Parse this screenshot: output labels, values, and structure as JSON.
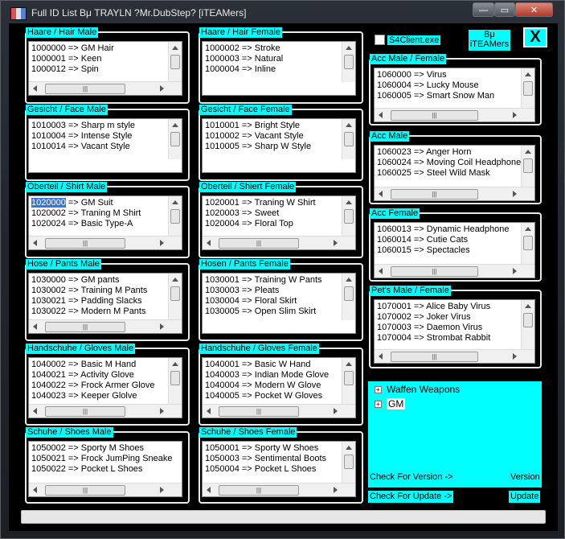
{
  "window": {
    "title": "Full ID List Bμ TRAYLN  ?Mr.DubStep? [iTEAMers]",
    "min_label": "—",
    "max_label": "▭",
    "close_label": "✕"
  },
  "checkbox": {
    "label": "S4Client.exe",
    "checked": false
  },
  "by_box": {
    "line1": "Bμ",
    "line2": "iTEAMers"
  },
  "x_button": "X",
  "groups": {
    "hair_male": {
      "label": "Haare / Hair Male",
      "items": [
        "1000000 => GM Hair",
        "1000001 => Keen",
        "1000012 => Spin"
      ]
    },
    "hair_female": {
      "label": "Haare / Hair Female",
      "items": [
        "1000002 => Stroke",
        "1000003 => Natural",
        "1000004 => Inline"
      ]
    },
    "face_male": {
      "label": "Gesicht / Face Male",
      "items": [
        "1010003 => Sharp m style",
        "1010004 => Intense Style",
        "1010014 => Vacant Style"
      ]
    },
    "face_female": {
      "label": "Gesicht / Face Female",
      "items": [
        "1010001 => Bright Style",
        "1010002 => Vacant Style",
        "1010005 => Sharp W Style"
      ]
    },
    "shirt_male": {
      "label": "Oberteil / Shirt Male",
      "selected_id": "1020000",
      "selected_rest": " => GM Suit",
      "items": [
        "1020002 => Traning M Shirt",
        "1020024 => Basic Type-A"
      ]
    },
    "shirt_female": {
      "label": "Oberteil / Shiert Female",
      "items": [
        "1020001 => Traning W Shirt",
        "1020003 => Sweet",
        "1020004 => Floral Top"
      ]
    },
    "pants_male": {
      "label": "Hose / Pants Male",
      "items": [
        "1030000 => GM pants",
        "1030002 => Training M Pants",
        "1030021 => Padding Slacks",
        "1030022 => Modern M Pants"
      ]
    },
    "pants_female": {
      "label": "Hosen / Pants Female",
      "items": [
        "1030001 => Training W Pants",
        "1030003 => Pleats",
        "1030004 => Floral Skirt",
        "1030005 => Open Slim Skirt"
      ]
    },
    "gloves_male": {
      "label": "Handschuhe / Gloves  Male",
      "items": [
        "1040002 => Basic M Hand",
        "1040021 => Activity Glove",
        "1040022 => Frock Armer Glove",
        "1040023 => Keeper Glolve"
      ]
    },
    "gloves_female": {
      "label": "Handschuhe / Gloves Female",
      "items": [
        "1040001 => Basic W Hand",
        "1040003 => Indian Mode Glove",
        "1040004 => Modern W Glove",
        "1040005 => Pocket W Gloves"
      ]
    },
    "shoes_male": {
      "label": "Schuhe / Shoes Male",
      "items": [
        "1050002 => Sporty M Shoes",
        "1050021 => Frock JumPing Sneake",
        "1050022 => Pocket L Shoes"
      ]
    },
    "shoes_female": {
      "label": "Schuhe / Shoes Female",
      "items": [
        "1050001 => Sporty W Shoes",
        "1050003 => Sentimental Boots",
        "1050004 => Pocket L Shoes"
      ]
    },
    "acc_male_female": {
      "label": "Acc Male / Female",
      "items": [
        "1060000 => Virus",
        "1060004 => Lucky Mouse",
        "1060005 => Smart Snow Man"
      ]
    },
    "acc_male": {
      "label": "Acc Male",
      "items": [
        "1060023 => Anger Horn",
        "1060024 => Moving Coil Headphone",
        "1060025 => Steel Wild Mask"
      ]
    },
    "acc_female": {
      "label": "Acc Female",
      "items": [
        "1060013 => Dynamic Headphone",
        "1060014 => Cutie Cats",
        "1060015 => Spectacles"
      ]
    },
    "pets": {
      "label": "Pet's Male / Female",
      "items": [
        "1070001 => Alice Baby Virus",
        "1070002 => Joker Virus",
        "1070003 => Daemon Virus",
        "1070004 => Strombat Rabbit"
      ]
    }
  },
  "tree": {
    "nodes": [
      "Waffen Weapons",
      "GM"
    ]
  },
  "buttons": {
    "check_version": "Check For Version ->",
    "check_update": "Check For Update ->",
    "version": "Version",
    "update": "Update"
  },
  "progress": {
    "value": 0.0
  }
}
